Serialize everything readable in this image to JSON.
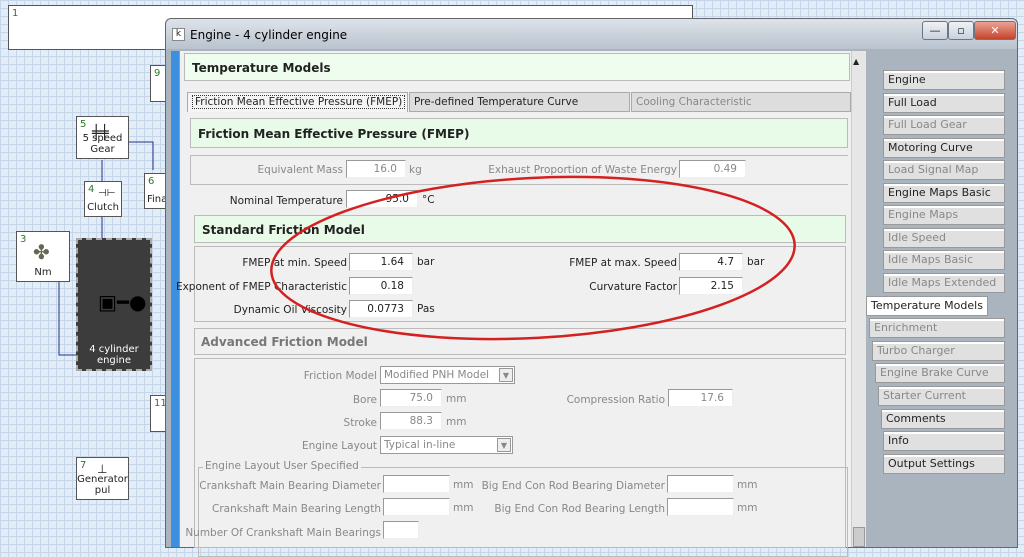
{
  "diagram": {
    "blocks": [
      {
        "num": "1",
        "label": ""
      },
      {
        "num": "9",
        "label": ""
      },
      {
        "num": "5",
        "label": "5 speed Gear"
      },
      {
        "num": "4",
        "label": "Clutch"
      },
      {
        "num": "6",
        "label": "Fina"
      },
      {
        "num": "3",
        "label": "Nm"
      },
      {
        "num": "",
        "label": "4 cylinder engine"
      },
      {
        "num": "11",
        "label": ""
      },
      {
        "num": "7",
        "label": "Generator pul"
      }
    ]
  },
  "window": {
    "title": "Engine - 4 cylinder engine",
    "app_icon": "k"
  },
  "header": {
    "title": "Temperature Models"
  },
  "tabs": [
    {
      "label": "Friction Mean Effective Pressure (FMEP)",
      "active": true
    },
    {
      "label": "Pre-defined Temperature Curve",
      "active": false
    },
    {
      "label": "Cooling Characteristic",
      "active": false,
      "disabled": true
    }
  ],
  "fmep": {
    "title": "Friction Mean Effective Pressure (FMEP)",
    "equivalent_mass": {
      "label": "Equivalent Mass",
      "value": "16.0",
      "unit": "kg"
    },
    "exhaust_proportion": {
      "label": "Exhaust Proportion of Waste Energy",
      "value": "0.49"
    },
    "nominal_temperature": {
      "label": "Nominal Temperature",
      "value": "95.0",
      "unit": "°C"
    }
  },
  "standard": {
    "title": "Standard Friction Model",
    "fmep_min": {
      "label": "FMEP at min. Speed",
      "value": "1.64",
      "unit": "bar"
    },
    "fmep_max": {
      "label": "FMEP at max. Speed",
      "value": "4.7",
      "unit": "bar"
    },
    "exponent": {
      "label": "Exponent of FMEP Characteristic",
      "value": "0.18"
    },
    "curvature": {
      "label": "Curvature Factor",
      "value": "2.15"
    },
    "viscosity": {
      "label": "Dynamic Oil Viscosity",
      "value": "0.0773",
      "unit": "Pas"
    }
  },
  "advanced": {
    "title": "Advanced Friction Model",
    "friction_model": {
      "label": "Friction Model",
      "value": "Modified PNH Model"
    },
    "bore": {
      "label": "Bore",
      "value": "75.0",
      "unit": "mm"
    },
    "compression": {
      "label": "Compression Ratio",
      "value": "17.6"
    },
    "stroke": {
      "label": "Stroke",
      "value": "88.3",
      "unit": "mm"
    },
    "layout": {
      "label": "Engine Layout",
      "value": "Typical in-line"
    },
    "group": "Engine Layout User Specified",
    "cmb_diameter": {
      "label": "Crankshaft Main Bearing Diameter",
      "value": "",
      "unit": "mm"
    },
    "bec_diameter": {
      "label": "Big End Con Rod Bearing Diameter",
      "value": "",
      "unit": "mm"
    },
    "cmb_length": {
      "label": "Crankshaft Main Bearing Length",
      "value": "",
      "unit": "mm"
    },
    "bec_length": {
      "label": "Big End Con Rod Bearing Length",
      "value": "",
      "unit": "mm"
    },
    "num_bearings": {
      "label": "Number Of Crankshaft Main Bearings",
      "value": ""
    }
  },
  "side_tabs": [
    {
      "label": "Engine",
      "enabled": true
    },
    {
      "label": "Full Load Characteristic",
      "enabled": true
    },
    {
      "label": "Full Load Gear Dependent",
      "enabled": false
    },
    {
      "label": "Motoring Curve",
      "enabled": true
    },
    {
      "label": "Load Signal Map",
      "enabled": false
    },
    {
      "label": "Engine Maps Basic",
      "enabled": true
    },
    {
      "label": "Engine Maps Extended",
      "enabled": false
    },
    {
      "label": "Idle Speed Characteristic",
      "enabled": false
    },
    {
      "label": "Idle Maps Basic",
      "enabled": false
    },
    {
      "label": "Idle Maps Extended",
      "enabled": false
    },
    {
      "label": "Temperature Models",
      "enabled": true,
      "active": true
    },
    {
      "label": "Enrichment",
      "enabled": false
    },
    {
      "label": "Turbo Charger",
      "enabled": false
    },
    {
      "label": "Engine Brake Curve",
      "enabled": false
    },
    {
      "label": "Starter Current Curves",
      "enabled": false
    },
    {
      "label": "Comments",
      "enabled": true
    },
    {
      "label": "Info",
      "enabled": true
    },
    {
      "label": "Output Settings",
      "enabled": true
    }
  ],
  "annotation_color": "#d42020"
}
